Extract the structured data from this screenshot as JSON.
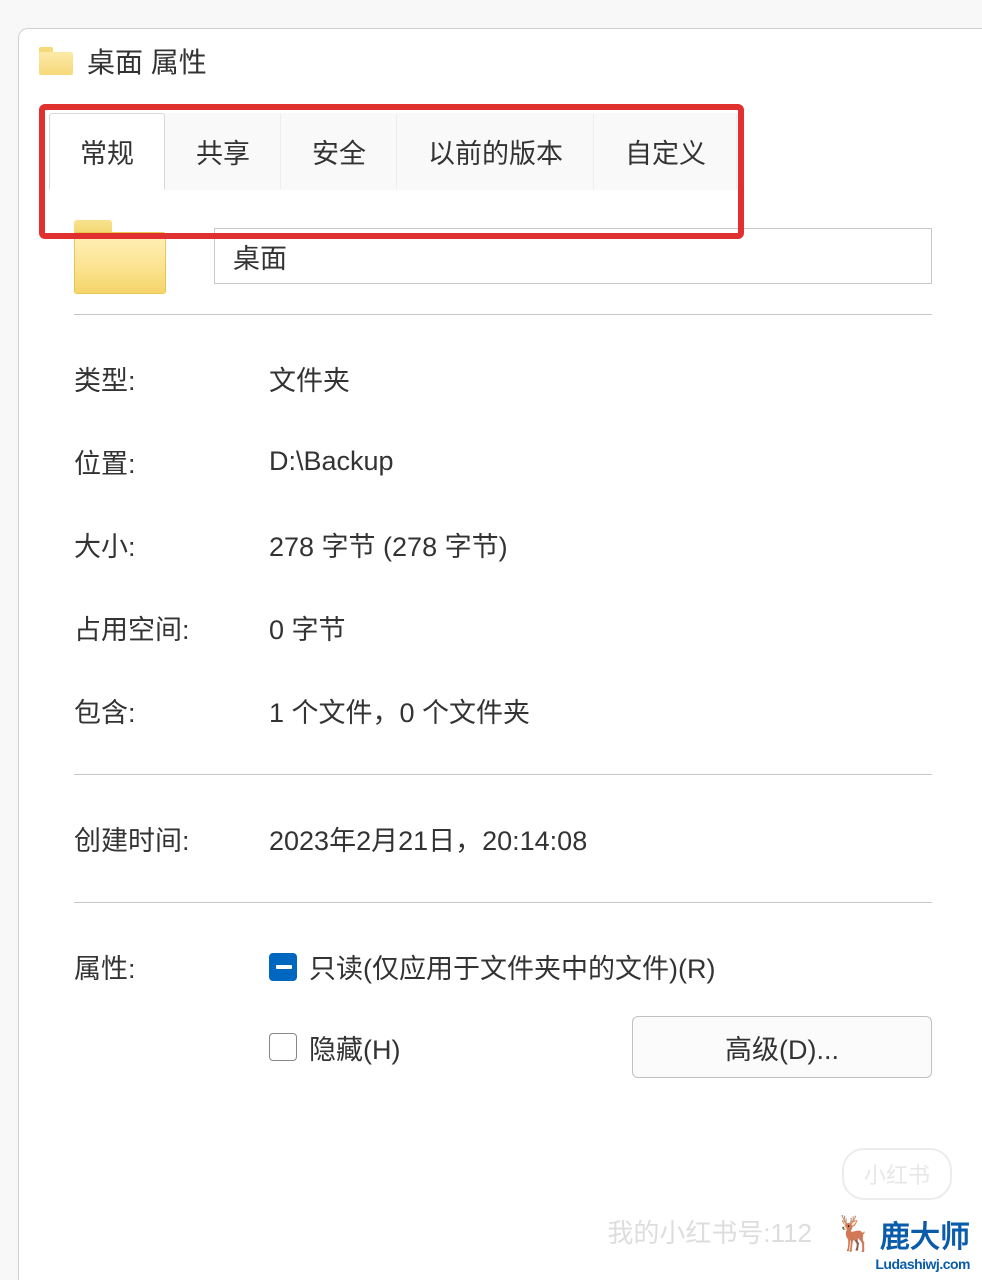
{
  "window": {
    "title": "桌面 属性"
  },
  "tabs": {
    "general": "常规",
    "sharing": "共享",
    "security": "安全",
    "previous": "以前的版本",
    "customize": "自定义"
  },
  "folder": {
    "name": "桌面"
  },
  "fields": {
    "type_label": "类型:",
    "type_value": "文件夹",
    "location_label": "位置:",
    "location_value": "D:\\Backup",
    "size_label": "大小:",
    "size_value": "278 字节 (278 字节)",
    "size_on_disk_label": "占用空间:",
    "size_on_disk_value": "0 字节",
    "contains_label": "包含:",
    "contains_value": "1 个文件，0 个文件夹",
    "created_label": "创建时间:",
    "created_value": "2023年2月21日，20:14:08",
    "attributes_label": "属性:"
  },
  "attributes": {
    "readonly_label": "只读(仅应用于文件夹中的文件)(R)",
    "hidden_label": "隐藏(H)",
    "advanced_button": "高级(D)..."
  },
  "watermark": {
    "pill": "小红书",
    "account": "我的小红书号:112",
    "logo_text": "鹿大师",
    "logo_url": "Ludashiwj.com"
  }
}
